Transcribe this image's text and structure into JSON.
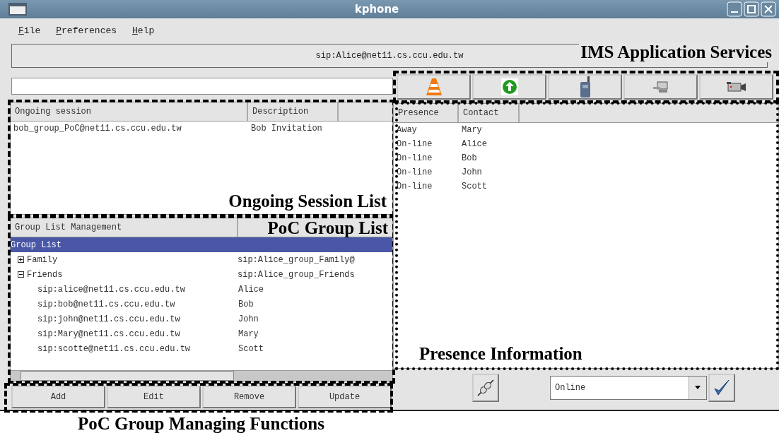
{
  "window": {
    "title": "kphone"
  },
  "menu": [
    "File",
    "Preferences",
    "Help"
  ],
  "sip_address": "sip:Alice@net11.cs.ccu.edu.tw",
  "session_list": {
    "columns": [
      "Ongoing session",
      "Description"
    ],
    "rows": [
      [
        "bob_group_PoC@net11.cs.ccu.edu.tw",
        "Bob Invitation"
      ]
    ]
  },
  "group_list": {
    "columns": [
      "Group List Management"
    ],
    "tree": [
      {
        "label": "Group List",
        "selected": true,
        "children": [
          {
            "label": "Family",
            "description": "sip:Alice_group_Family@",
            "expanded": false,
            "selected": false
          },
          {
            "label": "Friends",
            "description": "sip:Alice_group_Friends",
            "expanded": true,
            "selected": false,
            "children": [
              {
                "label": "sip:alice@net11.cs.ccu.edu.tw",
                "description": "Alice",
                "selected": false
              },
              {
                "label": "sip:bob@net11.cs.ccu.edu.tw",
                "description": "Bob",
                "selected": false
              },
              {
                "label": "sip:john@net11.cs.ccu.edu.tw",
                "description": "John",
                "selected": false
              },
              {
                "label": "sip:Mary@net11.cs.ccu.edu.tw",
                "description": "Mary",
                "selected": false
              },
              {
                "label": "sip:scotte@net11.cs.ccu.edu.tw",
                "description": "Scott",
                "selected": false
              }
            ]
          }
        ]
      }
    ]
  },
  "group_buttons": [
    "Add",
    "Edit",
    "Remove",
    "Update"
  ],
  "services": [
    {
      "kind": "cone"
    },
    {
      "kind": "upload"
    },
    {
      "kind": "phone"
    },
    {
      "kind": "computer"
    },
    {
      "kind": "camera"
    }
  ],
  "presence_list": {
    "columns": [
      "Presence",
      "Contact"
    ],
    "rows": [
      [
        "Away",
        "Mary"
      ],
      [
        "On-line",
        "Alice"
      ],
      [
        "On-line",
        "Bob"
      ],
      [
        "On-line",
        "John"
      ],
      [
        "On-line",
        "Scott"
      ]
    ]
  },
  "status": {
    "value": "Online"
  },
  "annotations": {
    "services": "IMS Application Services",
    "sessions": "Ongoing Session List",
    "groups": "PoC Group List",
    "presence": "Presence Information",
    "functions": "PoC Group Managing Functions"
  }
}
